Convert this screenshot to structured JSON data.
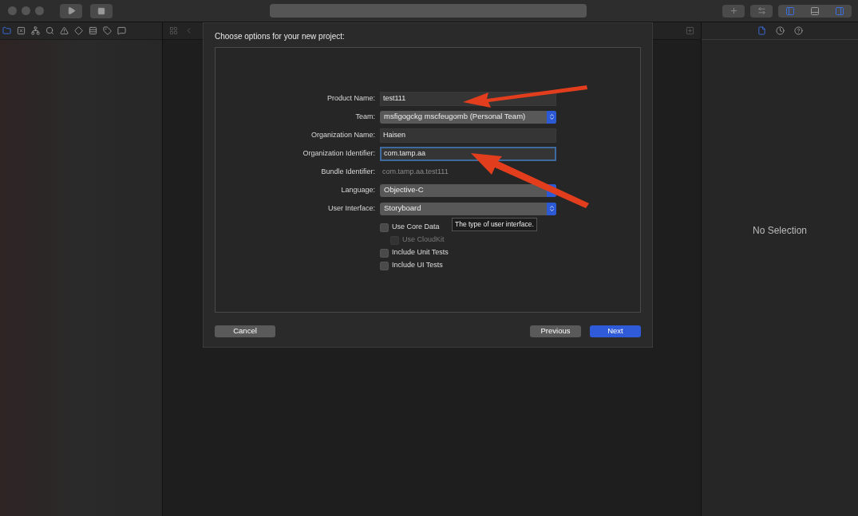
{
  "sheet": {
    "title": "Choose options for your new project:",
    "fields": [
      {
        "kind": "text",
        "label": "Product Name:",
        "value": "test111",
        "focused": false
      },
      {
        "kind": "popup",
        "label": "Team:",
        "value": "msfigogckg mscfeugomb (Personal Team)"
      },
      {
        "kind": "text",
        "label": "Organization Name:",
        "value": "Haisen",
        "focused": false
      },
      {
        "kind": "text",
        "label": "Organization Identifier:",
        "value": "com.tamp.aa",
        "focused": true
      },
      {
        "kind": "static",
        "label": "Bundle Identifier:",
        "value": "com.tamp.aa.test111"
      },
      {
        "kind": "popup",
        "label": "Language:",
        "value": "Objective-C"
      },
      {
        "kind": "popup",
        "label": "User Interface:",
        "value": "Storyboard"
      }
    ],
    "tooltip": "The type of user interface.",
    "checkboxes": [
      {
        "label": "Use Core Data",
        "checked": false,
        "disabled": false,
        "children": [
          {
            "label": "Use CloudKit",
            "checked": false,
            "disabled": true
          }
        ]
      },
      {
        "label": "Include Unit Tests",
        "checked": false,
        "disabled": false
      },
      {
        "label": "Include UI Tests",
        "checked": false,
        "disabled": false
      }
    ],
    "buttons": [
      {
        "label": "Cancel",
        "kind": "normal"
      },
      {
        "label": "Previous",
        "kind": "normal"
      },
      {
        "label": "Next",
        "kind": "default"
      }
    ]
  },
  "inspector": {
    "empty_text": "No Selection"
  }
}
